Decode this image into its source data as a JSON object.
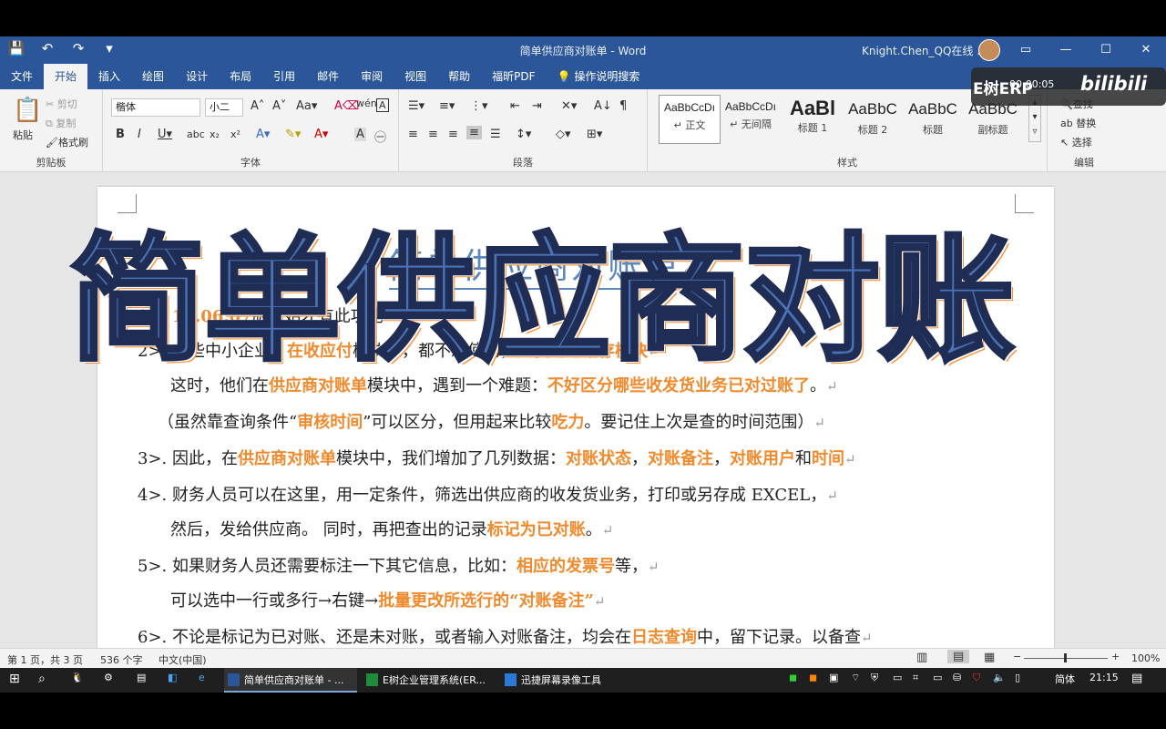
{
  "window": {
    "doc_title": "简单供应商对账单 - Word",
    "user": "Knight.Chen_QQ在线 ...",
    "qat": [
      "💾",
      "↶",
      "↷",
      "▾"
    ],
    "win_buttons": [
      "▭",
      "—",
      "☐",
      "✕"
    ]
  },
  "ribbon": {
    "tabs": [
      "文件",
      "开始",
      "插入",
      "绘图",
      "设计",
      "布局",
      "引用",
      "邮件",
      "审阅",
      "视图",
      "帮助",
      "福昕PDF",
      "操作说明搜索"
    ],
    "clipboard": {
      "paste": "粘贴",
      "cut": "剪切",
      "copy": "复制",
      "format_painter": "格式刷",
      "label": "剪贴板"
    },
    "font": {
      "name": "楷体",
      "size": "小二",
      "label": "字体"
    },
    "paragraph": {
      "label": "段落"
    },
    "styles": {
      "label": "样式",
      "items": [
        {
          "sample": "AaBbCcDı",
          "name": "↵ 正文"
        },
        {
          "sample": "AaBbCcDı",
          "name": "↵ 无间隔"
        },
        {
          "sample": "AaBl",
          "name": "标题 1"
        },
        {
          "sample": "AaBbC",
          "name": "标题 2"
        },
        {
          "sample": "AaBbC",
          "name": "标题"
        },
        {
          "sample": "AaBbC",
          "name": "副标题"
        }
      ]
    },
    "editing": {
      "find": "查找",
      "replace": "替换",
      "select": "选择",
      "label": "编辑"
    }
  },
  "watermark": {
    "brand": "E树ERP",
    "time": "00:00:05",
    "site": "bilibili"
  },
  "document": {
    "heading": "简单供应商对账单",
    "overlay": "简单供应商对账"
  },
  "status": {
    "page": "第 1 页，共 3 页",
    "words": "536 个字",
    "lang": "中文(中国)",
    "zoom": "100%"
  },
  "taskbar": {
    "apps": [
      "简单供应商对账单 - ...",
      "E树企业管理系统(ER...",
      "迅捷屏幕录像工具"
    ],
    "ime": "简体",
    "time": "21:15"
  },
  "colors": {
    "word_blue": "#2b579a",
    "highlight": "#f08a2c",
    "heading": "#5b87bf"
  }
}
